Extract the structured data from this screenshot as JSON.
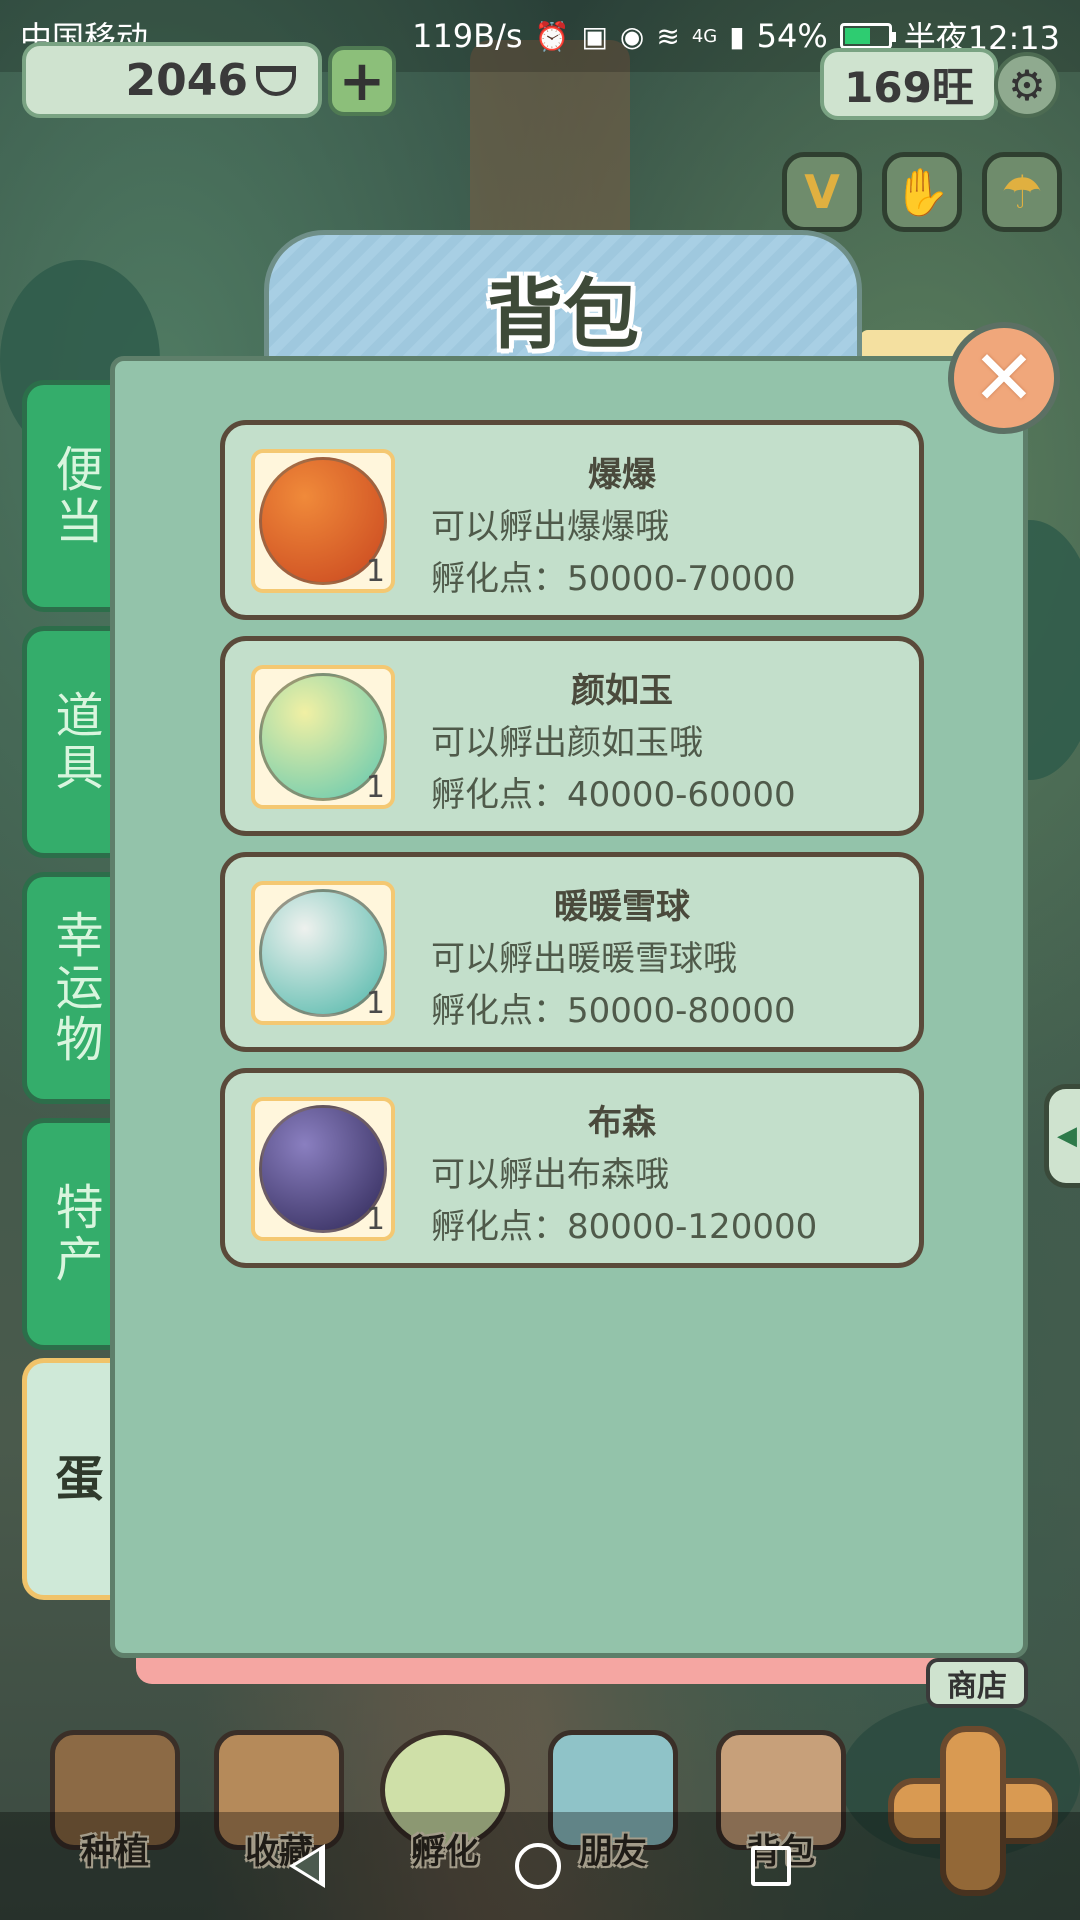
{
  "status_bar": {
    "carrier": "中国移动",
    "speed": "119B/s",
    "network": "4G",
    "battery": "54%",
    "battery_level": 0.54,
    "time": "半夜12:13"
  },
  "hud": {
    "coins": "2046",
    "add": "+",
    "wang": "169旺",
    "quick_buttons": [
      "V",
      "✋",
      "☂"
    ]
  },
  "bag": {
    "title": "背包",
    "close": "✕",
    "tabs": [
      {
        "label": "便当",
        "active": false
      },
      {
        "label": "道具",
        "active": false
      },
      {
        "label": "幸运物",
        "active": false
      },
      {
        "label": "特产",
        "active": false
      },
      {
        "label": "蛋",
        "active": true
      }
    ],
    "items": [
      {
        "name": "爆爆",
        "desc": "可以孵出爆爆哦",
        "points": "孵化点：50000-70000",
        "count": "1",
        "color_a": "#f08a3a",
        "color_b": "#c9461f"
      },
      {
        "name": "颜如玉",
        "desc": "可以孵出颜如玉哦",
        "points": "孵化点：40000-60000",
        "count": "1",
        "color_a": "#f1f0a4",
        "color_b": "#5fc7b0"
      },
      {
        "name": "暖暖雪球",
        "desc": "可以孵出暖暖雪球哦",
        "points": "孵化点：50000-80000",
        "count": "1",
        "color_a": "#eef1ee",
        "color_b": "#4cb6a8"
      },
      {
        "name": "布森",
        "desc": "可以孵出布森哦",
        "points": "孵化点：80000-120000",
        "count": "1",
        "color_a": "#8a7fc0",
        "color_b": "#2e2756"
      }
    ]
  },
  "shop_label": "商店",
  "bottom_nav": [
    {
      "label": "种植",
      "color": "#8c6a45"
    },
    {
      "label": "收藏",
      "color": "#b58a5a"
    },
    {
      "label": "孵化",
      "color": "#cfe0a8"
    },
    {
      "label": "朋友",
      "color": "#8fc3c8"
    },
    {
      "label": "背包",
      "color": "#c7a07a"
    }
  ]
}
